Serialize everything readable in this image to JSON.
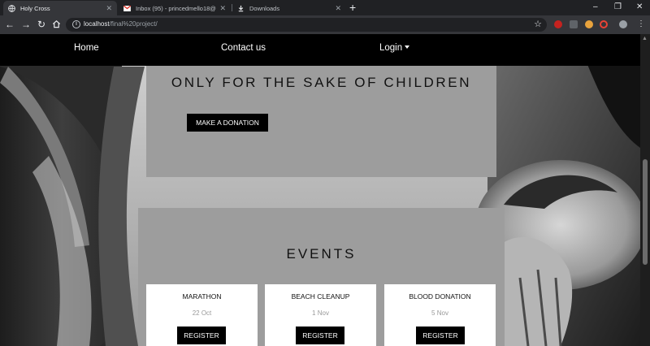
{
  "browser": {
    "tabs": [
      {
        "title": "Holy Cross",
        "active": true,
        "icon": "globe-icon"
      },
      {
        "title": "Inbox (95) - princedmello18@gm",
        "active": false,
        "icon": "gmail-icon"
      },
      {
        "title": "Downloads",
        "active": false,
        "icon": "download-icon"
      }
    ],
    "new_tab": "+",
    "controls": {
      "minimize": "–",
      "restore": "❐",
      "close": "✕"
    },
    "url_host": "localhost",
    "url_path": "/final%20project/",
    "colors": {
      "tabstrip": "#202124",
      "toolbar": "#35363a"
    }
  },
  "nav": {
    "home": "Home",
    "contact": "Contact us",
    "login": "Login"
  },
  "hero": {
    "title": "ONLY FOR THE SAKE OF CHILDREN",
    "donate_label": "MAKE A DONATION"
  },
  "events": {
    "title": "EVENTS",
    "items": [
      {
        "name": "MARATHON",
        "date": "22 Oct",
        "button": "REGISTER"
      },
      {
        "name": "BEACH CLEANUP",
        "date": "1 Nov",
        "button": "REGISTER"
      },
      {
        "name": "BLOOD DONATION",
        "date": "5 Nov",
        "button": "REGISTER"
      }
    ]
  },
  "colors": {
    "panel": "#9d9d9d",
    "button": "#000000",
    "navbar": "#000000"
  }
}
